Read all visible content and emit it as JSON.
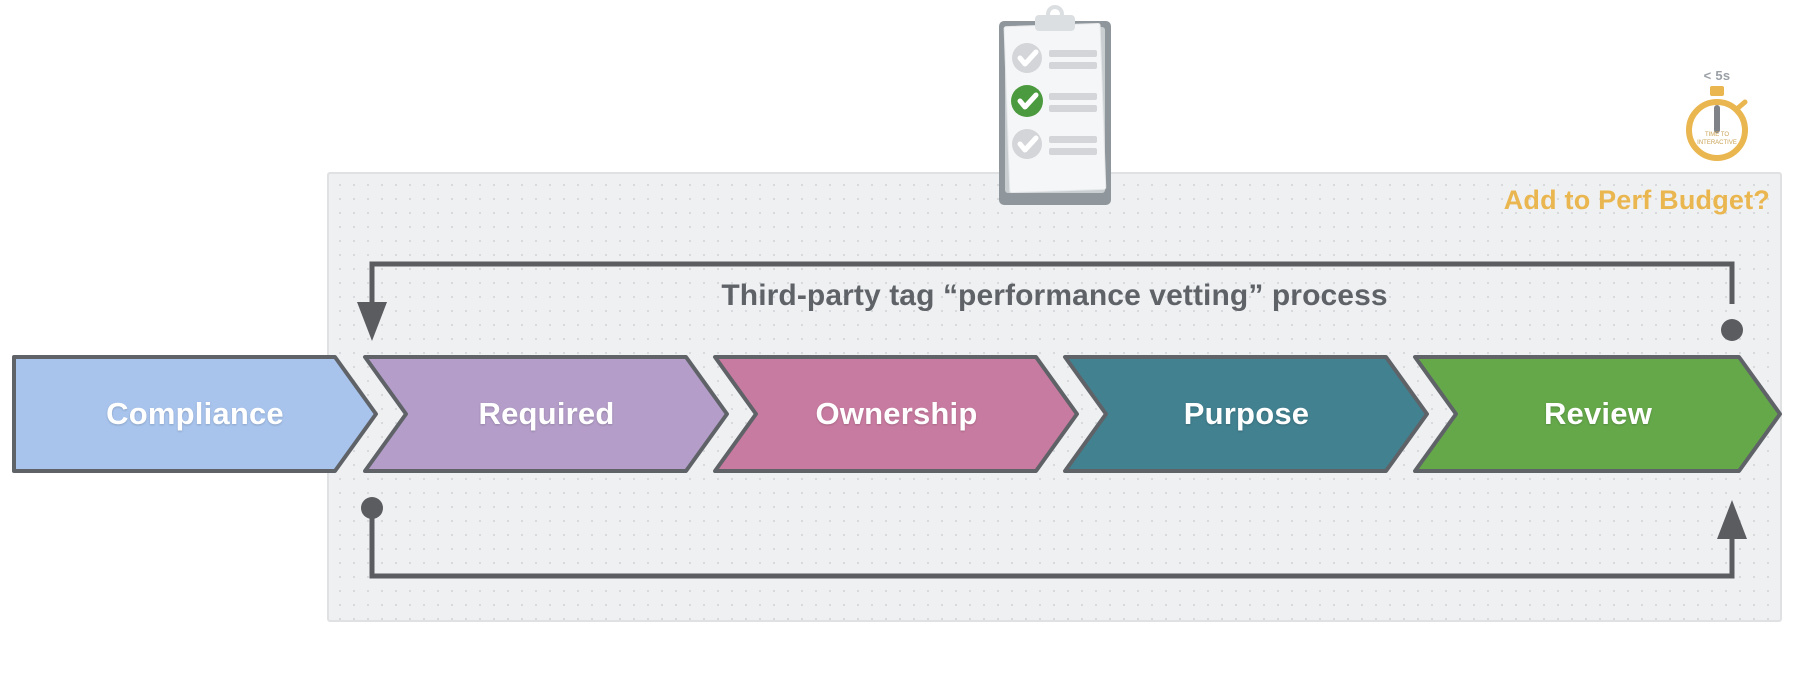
{
  "panel": {
    "process_title": "Third-party tag “performance vetting” process",
    "perf_budget_label": "Add to Perf Budget?",
    "background_color": "#eff0f2",
    "border_color": "#e0e1e3"
  },
  "stages": [
    {
      "label": "Compliance",
      "fill": "#a8c4ed",
      "stroke": "#5f6368"
    },
    {
      "label": "Required",
      "fill": "#b49ec9",
      "stroke": "#5f6368"
    },
    {
      "label": "Ownership",
      "fill": "#c87ba0",
      "stroke": "#5f6368"
    },
    {
      "label": "Purpose",
      "fill": "#428190",
      "stroke": "#5f6368"
    },
    {
      "label": "Review",
      "fill": "#65a84a",
      "stroke": "#5f6368"
    }
  ],
  "connectors": {
    "line_color": "#5a5c60",
    "top": {
      "from": "review-end-dot",
      "to": "compliance-start-arrow",
      "start_marker": "dot",
      "end_marker": "arrow"
    },
    "bottom": {
      "from": "compliance-start-dot",
      "to": "review-end-arrow",
      "start_marker": "dot",
      "end_marker": "arrow"
    }
  },
  "clipboard": {
    "icon_name": "clipboard-checklist-icon",
    "board_color": "#8f979c",
    "paper_color": "#f5f6f7",
    "checks": [
      {
        "state": "inactive",
        "color": "#d3d5d8"
      },
      {
        "state": "active",
        "color": "#4c9a3f"
      },
      {
        "state": "inactive",
        "color": "#d3d5d8"
      }
    ]
  },
  "stopwatch": {
    "icon_name": "stopwatch-icon",
    "above_label": "< 5s",
    "face_line_1": "TIME TO",
    "face_line_2": "INTERACTIVE",
    "color": "#eab64f",
    "needle_color": "#7f8387"
  }
}
